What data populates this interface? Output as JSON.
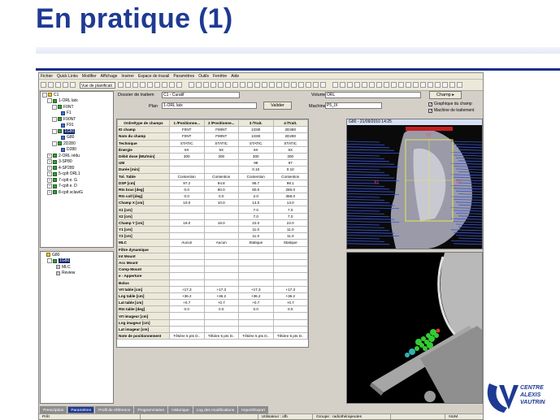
{
  "slide": {
    "title": "En pratique (1)"
  },
  "app": {
    "menu": [
      "Fichier",
      "Quick Links",
      "Modifier",
      "Affichage",
      "Insérer",
      "Espace de travail",
      "Paramètres",
      "Outils",
      "Fenêtre",
      "Aide"
    ],
    "view_select": "Vue de planificati",
    "tree_top": [
      {
        "label": "C1",
        "icon": "yellow",
        "indent": 0,
        "exp": "-"
      },
      {
        "label": "1-ORL latx",
        "icon": "green",
        "indent": 1,
        "exp": "-"
      },
      {
        "label": "F0NT",
        "icon": "green",
        "indent": 2,
        "exp": "-"
      },
      {
        "label": "F1",
        "icon": "blue",
        "indent": 3,
        "exp": ""
      },
      {
        "label": "F90NT",
        "icon": "green",
        "indent": 2,
        "exp": "-"
      },
      {
        "label": "F91",
        "icon": "blue",
        "indent": 3,
        "exp": ""
      },
      {
        "label": "1G80",
        "icon": "green",
        "indent": 2,
        "exp": "-",
        "selected": true
      },
      {
        "label": "G80",
        "icon": "blue",
        "indent": 3,
        "exp": ""
      },
      {
        "label": "2D280",
        "icon": "green",
        "indent": 2,
        "exp": "-"
      },
      {
        "label": "D280",
        "icon": "blue",
        "indent": 3,
        "exp": ""
      },
      {
        "label": "2-ORL rédu",
        "icon": "green",
        "indent": 1,
        "exp": "+"
      },
      {
        "label": "3-SP80",
        "icon": "green",
        "indent": 1,
        "exp": "+"
      },
      {
        "label": "4-SP280",
        "icon": "green",
        "indent": 1,
        "exp": "+"
      },
      {
        "label": "5-cplt ORL1",
        "icon": "green",
        "indent": 1,
        "exp": "+"
      },
      {
        "label": "7-cplt e. G",
        "icon": "green",
        "indent": 1,
        "exp": "+"
      },
      {
        "label": "7-cplt e. D",
        "icon": "green",
        "indent": 1,
        "exp": "+"
      },
      {
        "label": "8-cplt sclaviG",
        "icon": "green",
        "indent": 1,
        "exp": "+"
      }
    ],
    "tree_bottom": [
      {
        "label": "G80",
        "icon": "yellow",
        "indent": 0,
        "exp": ""
      },
      {
        "label": "1G80",
        "icon": "green",
        "indent": 1,
        "exp": "-",
        "selected": true
      },
      {
        "label": "MLC",
        "icon": "gray",
        "indent": 2,
        "exp": ""
      },
      {
        "label": "Review",
        "icon": "gray",
        "indent": 2,
        "exp": ""
      }
    ],
    "header": {
      "dossier_label": "Dossier de traitem",
      "dossier_value": "C1 - Curatif",
      "plan_label": "Plan",
      "plan_value": "1-ORL latx",
      "valider": "Valider",
      "volume_label": "Volume",
      "volume_value": "ORL",
      "machine_label": "Machine",
      "machine_value": "P5_IX",
      "champ_btn": "Champ",
      "check1": "Graphique du champ",
      "check2": "Machine de traitement"
    },
    "table": {
      "headers": [
        "Ordre/type de champs",
        "1 /Positionne...",
        "2 /Positionne...",
        "3 /Trait.",
        "4 /Trait."
      ],
      "rows": [
        [
          "ID champ",
          "F0NT",
          "F90NT",
          "1G80",
          "2D280"
        ],
        [
          "Nom du champ",
          "F0NT",
          "F90NT",
          "1G80",
          "2D280"
        ],
        [
          "Technique",
          "STATIC",
          "STATIC",
          "STATIC",
          "STATIC"
        ],
        [
          "Énergie",
          "6X",
          "6X",
          "6X",
          "6X"
        ],
        [
          "Débit dose [MU/min]",
          "300",
          "300",
          "300",
          "300"
        ],
        [
          "UM",
          "",
          "",
          "98",
          "97"
        ],
        [
          "Durée [min]",
          "",
          "",
          "0.10",
          "0.10"
        ],
        [
          "Tol. Table",
          "Contention",
          "Contention",
          "Contention",
          "Contention"
        ],
        [
          "DSP [cm]",
          "97.2",
          "94.8",
          "95.7",
          "98.1"
        ],
        [
          "Rtn bras [deg]",
          "0.0",
          "90.0",
          "80.0",
          "280.0"
        ],
        [
          "Rtn coll [deg]",
          "0.0",
          "0.0",
          "2.0",
          "358.0"
        ],
        [
          "Champ X [cm]",
          "10.0",
          "10.0",
          "14.0",
          "14.0"
        ],
        [
          "X1 [cm]",
          "",
          "",
          "7.0",
          "7.0"
        ],
        [
          "X2 [cm]",
          "",
          "",
          "7.0",
          "7.0"
        ],
        [
          "Champ Y [cm]",
          "16.0",
          "16.0",
          "22.0",
          "22.0"
        ],
        [
          "Y1 [cm]",
          "",
          "",
          "11.0",
          "11.0"
        ],
        [
          "Y2 [cm]",
          "",
          "",
          "11.0",
          "11.0"
        ],
        [
          "MLC",
          "Aucun",
          "Aucun",
          "Statique",
          "Statique"
        ],
        [
          "Filtre dynamique",
          "",
          "",
          "",
          ""
        ],
        [
          "Int Mount",
          "",
          "",
          "",
          ""
        ],
        [
          "Acc Mount",
          "",
          "",
          "",
          ""
        ],
        [
          "Comp Mount",
          "",
          "",
          "",
          ""
        ],
        [
          "e - Apperture",
          "",
          "",
          "",
          ""
        ],
        [
          "Bolus",
          "",
          "",
          "",
          ""
        ],
        [
          "Vrt table [cm]",
          "+17.3",
          "+17.3",
          "+17.3",
          "+17.3"
        ],
        [
          "Lng table [cm]",
          "+36.2",
          "+36.2",
          "+36.2",
          "+36.2"
        ],
        [
          "Lat table [cm]",
          "+0.7",
          "+0.7",
          "+0.7",
          "+0.7"
        ],
        [
          "Rtn table [deg]",
          "0.0",
          "0.0",
          "0.0",
          "0.0"
        ],
        [
          "Vrt imageur [cm]",
          "",
          "",
          "",
          ""
        ],
        [
          "Lng imageur [cm]",
          "",
          "",
          "",
          ""
        ],
        [
          "Lat imageur [cm]",
          "",
          "",
          "",
          ""
        ],
        [
          "Note de positionnement",
          "Têtière 5 pts  D..",
          "Têtière 5 pts  D..",
          "Têtière 5 pts  D..",
          "Têtière 5 pts  D.."
        ]
      ]
    },
    "view_title": "G80 - 21/09/2010 14:25",
    "drr_labels": {
      "left": "X1",
      "right": "X2",
      "top": "Y2"
    },
    "tabs": [
      "Prescription",
      "Paramètres",
      "Profil de référence",
      "Programmation",
      "Historique",
      "Log des modifications",
      "Import/Export"
    ],
    "active_tab": 1,
    "status": [
      "Prêt",
      "",
      "Utilisateur : ofb",
      "Groupe : radiothérapeutes",
      "",
      "NUM"
    ]
  },
  "logo": {
    "line1": "CENTRE",
    "line2": "ALEXIS",
    "line3": "VAUTRIN",
    "color": "#1f3a93"
  }
}
